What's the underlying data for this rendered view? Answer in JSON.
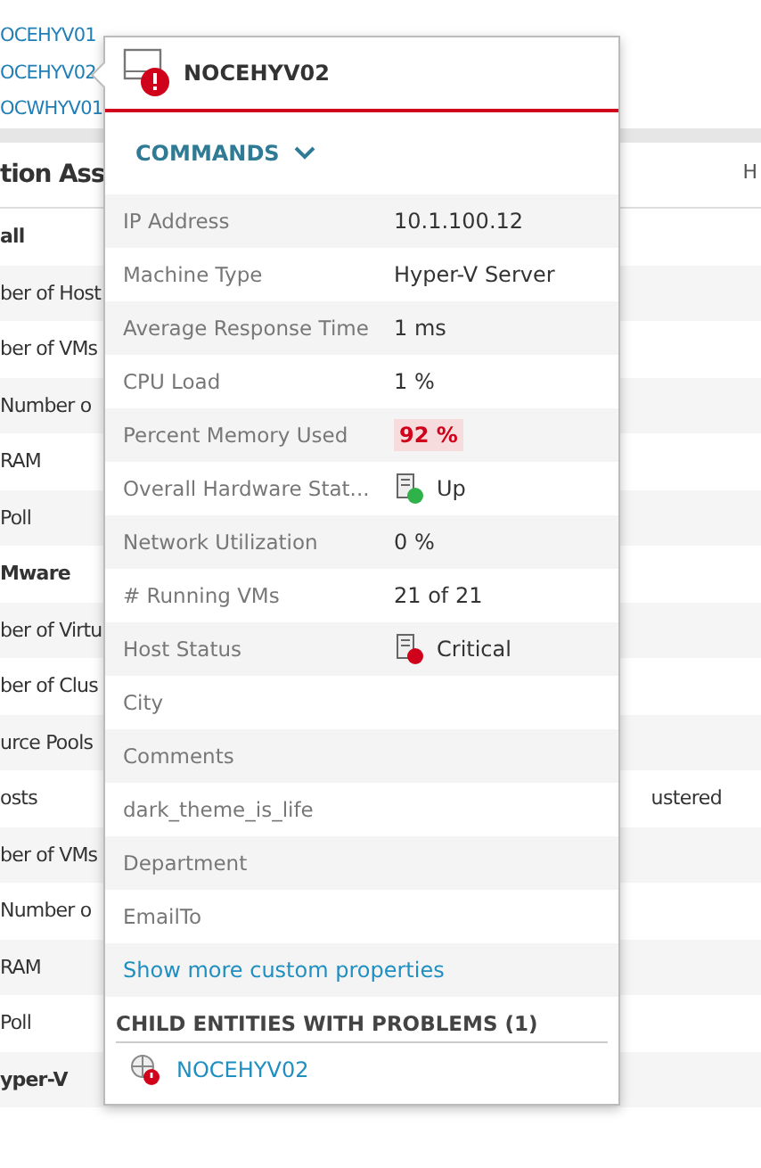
{
  "background": {
    "links": [
      "OCEHYV01",
      "OCEHYV02",
      "OCWHYV01"
    ],
    "section_title": "tion Ass",
    "header_fragment": "H",
    "rows": [
      {
        "kind": "group",
        "label": "all"
      },
      {
        "kind": "row",
        "label": "ber of Host"
      },
      {
        "kind": "row",
        "label": "ber of VMs"
      },
      {
        "kind": "row",
        "label": "Number o"
      },
      {
        "kind": "row",
        "label": "RAM"
      },
      {
        "kind": "row",
        "label": "Poll"
      },
      {
        "kind": "group",
        "label": "Mware"
      },
      {
        "kind": "row",
        "label": "ber of Virtu"
      },
      {
        "kind": "row",
        "label": "ber of Clus"
      },
      {
        "kind": "row",
        "label": "urce Pools"
      },
      {
        "kind": "row",
        "label": "osts",
        "value": "ustered"
      },
      {
        "kind": "row",
        "label": "ber of VMs"
      },
      {
        "kind": "row",
        "label": "Number o"
      },
      {
        "kind": "row",
        "label": "RAM"
      },
      {
        "kind": "row",
        "label": "Poll"
      },
      {
        "kind": "group",
        "label": "yper-V"
      }
    ]
  },
  "popup": {
    "title": "NOCEHYV02",
    "color": "#d0021b",
    "commands": "COMMANDS",
    "properties": [
      {
        "label": "IP Address",
        "value": "10.1.100.12"
      },
      {
        "label": "Machine Type",
        "value": "Hyper-V Server"
      },
      {
        "label": "Average Response Time",
        "value": "1 ms"
      },
      {
        "label": "CPU Load",
        "value": "1 %"
      },
      {
        "label": "Percent Memory Used",
        "value": "92 %",
        "alert": true
      },
      {
        "label": "Overall Hardware Stat...",
        "value": "Up",
        "color": "#2fb24a"
      },
      {
        "label": "Network Utilization",
        "value": "0 %"
      },
      {
        "label": "# Running VMs",
        "value": "21 of 21"
      },
      {
        "label": "Host Status",
        "value": "Critical",
        "color": "#d0021b"
      },
      {
        "label": "City"
      },
      {
        "label": "Comments"
      },
      {
        "label": "dark_theme_is_life"
      },
      {
        "label": "Department"
      },
      {
        "label": "EmailTo"
      }
    ],
    "more_link": "Show more custom properties",
    "child_heading": "CHILD ENTITIES WITH PROBLEMS (1)",
    "children": [
      {
        "name": "NOCEHYV02",
        "color": "#d0021b"
      }
    ]
  }
}
